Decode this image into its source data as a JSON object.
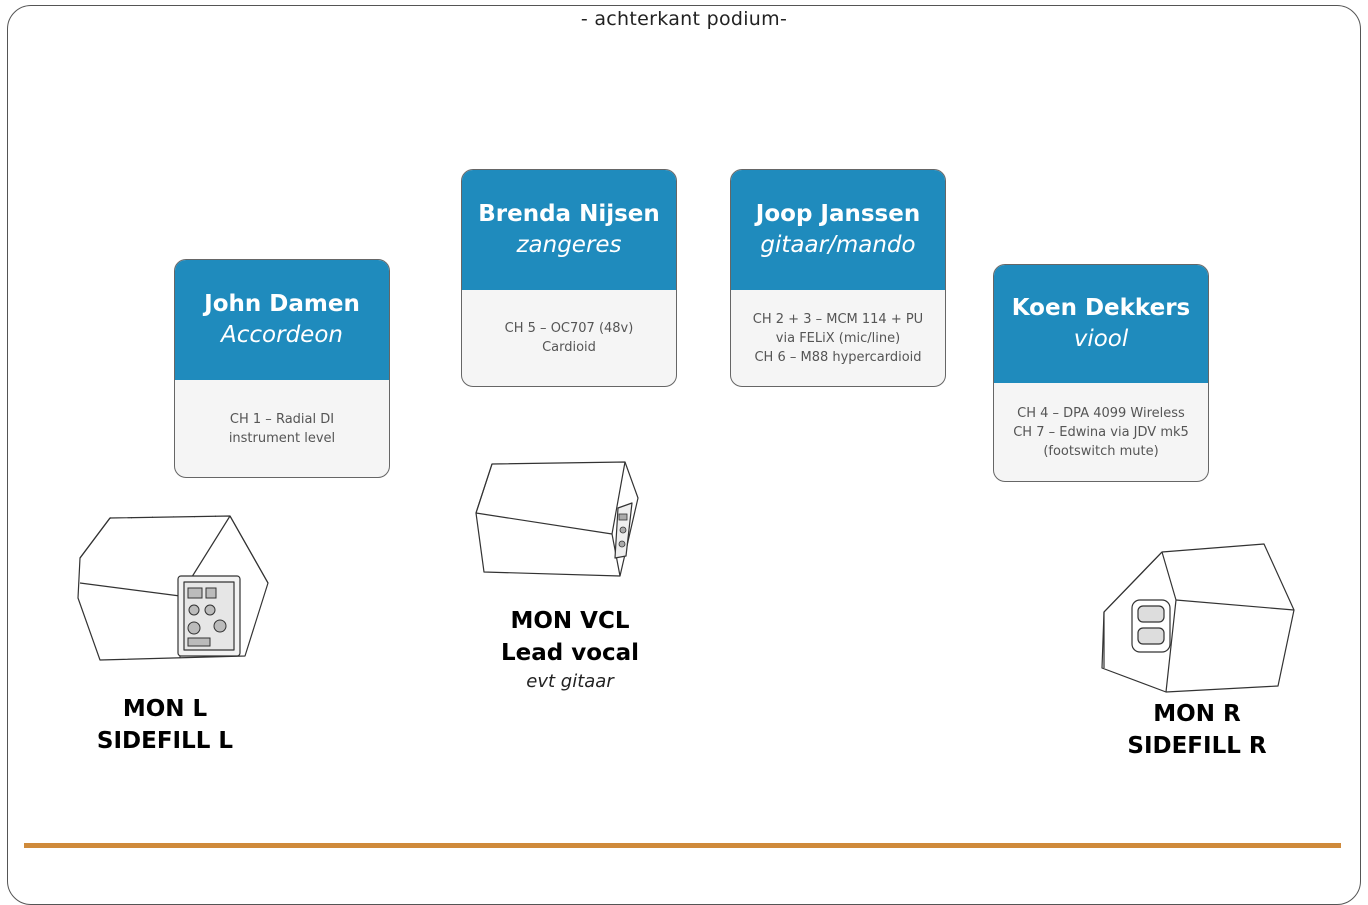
{
  "header": "- achterkant podium-",
  "cards": [
    {
      "name": "John Damen",
      "role": "Accordeon",
      "lines": [
        "CH 1 – Radial DI",
        "instrument level"
      ]
    },
    {
      "name": "Brenda Nijsen",
      "role": "zangeres",
      "lines": [
        "CH 5 – OC707 (48v)",
        "Cardioid"
      ]
    },
    {
      "name": "Joop Janssen",
      "role": "gitaar/mando",
      "lines": [
        "CH 2 + 3 – MCM 114 + PU",
        "via FELiX (mic/line)",
        "CH 6 – M88 hypercardioid"
      ]
    },
    {
      "name": "Koen Dekkers",
      "role": "viool",
      "lines": [
        "CH 4 – DPA 4099 Wireless",
        "CH 7 – Edwina via JDV mk5",
        "(footswitch mute)"
      ]
    }
  ],
  "monitors": {
    "left": {
      "line1": "MON L",
      "line2": "SIDEFILL L"
    },
    "center": {
      "line1": "MON VCL",
      "line2": "Lead vocal",
      "sub": "evt gitaar"
    },
    "right": {
      "line1": "MON R",
      "line2": "SIDEFILL R"
    }
  },
  "icons": {
    "left_monitor": "monitor-wedge-icon",
    "center_monitor": "monitor-wedge-icon",
    "right_monitor": "monitor-wedge-icon"
  },
  "colors": {
    "card_header": "#1f8bbd",
    "card_body": "#f5f5f5",
    "accent_line": "#cf8a3b"
  }
}
